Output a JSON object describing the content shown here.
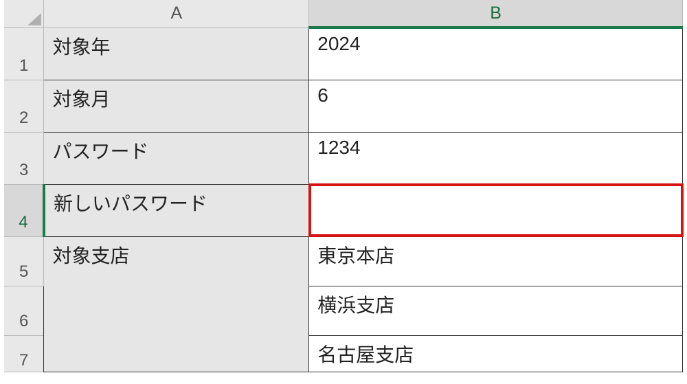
{
  "columns": {
    "A": "A",
    "B": "B"
  },
  "row_numbers": [
    "1",
    "2",
    "3",
    "4",
    "5",
    "6",
    "7"
  ],
  "cells": {
    "A1": "対象年",
    "B1": "2024",
    "A2": "対象月",
    "B2": "6",
    "A3": "パスワード",
    "B3": "1234",
    "A4": "新しいパスワード",
    "B4": "",
    "A5": "対象支店",
    "B5": "東京本店",
    "B6": "横浜支店",
    "B7": "名古屋支店"
  },
  "selected_cell": "B4"
}
